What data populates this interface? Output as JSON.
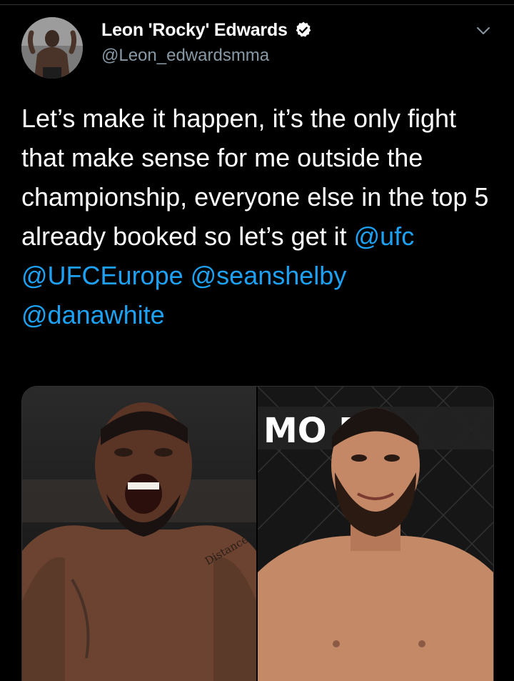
{
  "author": {
    "display_name": "Leon 'Rocky' Edwards",
    "handle": "@Leon_edwardsmma",
    "verified": true,
    "avatar_icon": "profile-photo"
  },
  "tweet": {
    "text_segments": [
      {
        "type": "text",
        "value": "Let’s make it happen, it’s the only fight that make sense for me outside the championship, everyone else in the top 5 already booked so let’s get it "
      },
      {
        "type": "mention",
        "value": "@ufc"
      },
      {
        "type": "text",
        "value": " "
      },
      {
        "type": "mention",
        "value": "@UFCEurope"
      },
      {
        "type": "text",
        "value": " "
      },
      {
        "type": "mention",
        "value": "@seanshelby"
      },
      {
        "type": "text",
        "value": " "
      },
      {
        "type": "mention",
        "value": "@danawhite"
      }
    ]
  },
  "media": {
    "left_photo_text": "Distance",
    "right_photo_text": "MO E"
  },
  "colors": {
    "background": "#000000",
    "text": "#ffffff",
    "secondary": "#8899a6",
    "link": "#1da1f2",
    "verified": "#ffffff"
  },
  "icons": {
    "verified": "verified-badge-icon",
    "more": "chevron-down-icon"
  }
}
